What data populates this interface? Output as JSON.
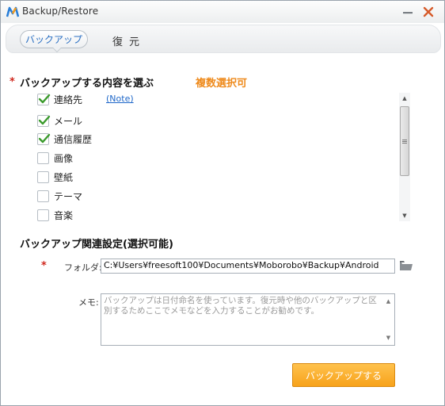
{
  "window": {
    "title": "Backup/Restore",
    "accent_color": "#2a6fc2",
    "orange_color": "#f7a21b",
    "required_color": "#d0281e"
  },
  "tabs": [
    {
      "label": "バックアップ",
      "active": true
    },
    {
      "label": "復元",
      "active": false
    }
  ],
  "content_section": {
    "required_mark": "*",
    "title": "バックアップする内容を選ぶ",
    "note": "複数選択可",
    "note_link": "(Note)",
    "items": [
      {
        "label": "連絡先",
        "checked": true
      },
      {
        "label": "メール",
        "checked": true
      },
      {
        "label": "通信履歴",
        "checked": true
      },
      {
        "label": "画像",
        "checked": false
      },
      {
        "label": "壁紙",
        "checked": false
      },
      {
        "label": "テーマ",
        "checked": false
      },
      {
        "label": "音楽",
        "checked": false
      }
    ]
  },
  "settings_section": {
    "title": "バックアップ関連設定(選択可能)",
    "required_mark": "*",
    "folder_label": "フォルダ:",
    "folder_value": "C:¥Users¥freesoft100¥Documents¥Moborobo¥Backup¥Android",
    "memo_label": "メモ:",
    "memo_placeholder": "バックアップは日付命名を使っています。復元時や他のバックアップと区別するためここでメモなどを入力することがお勧めです。"
  },
  "actions": {
    "backup_button": "バックアップする"
  }
}
